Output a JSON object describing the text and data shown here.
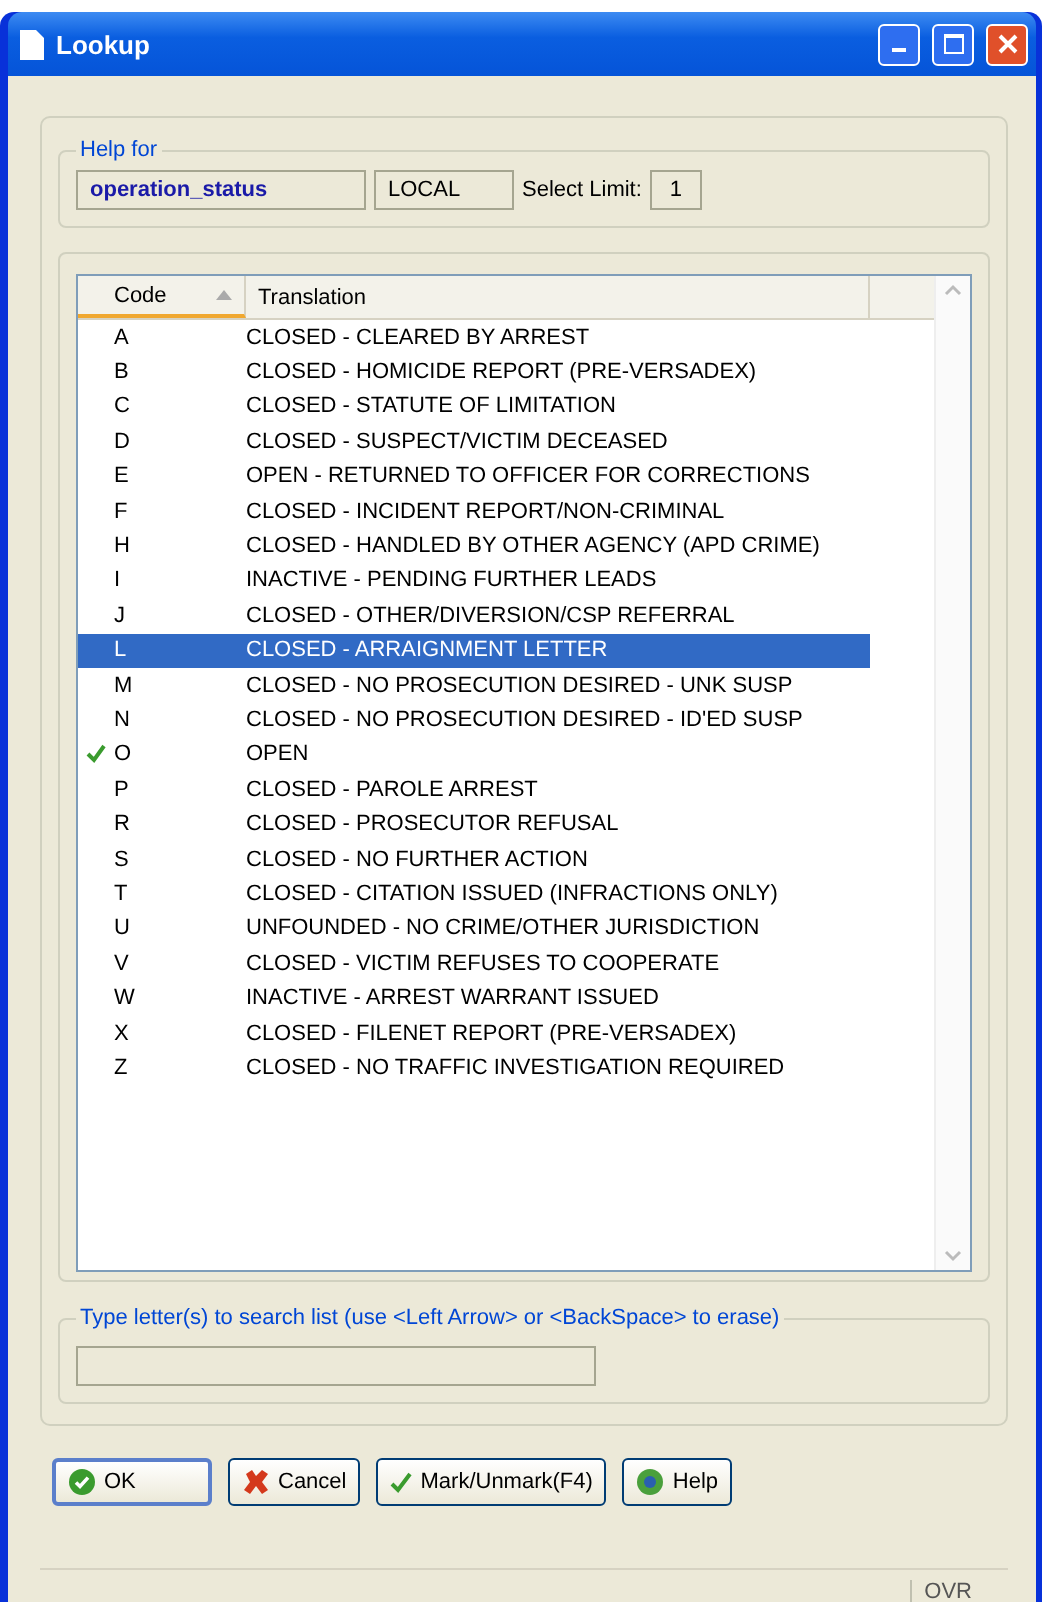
{
  "window": {
    "title": "Lookup"
  },
  "help_for": {
    "legend": "Help for",
    "field": "operation_status",
    "scope": "LOCAL",
    "select_limit_label": "Select Limit:",
    "select_limit": "1"
  },
  "table": {
    "columns": [
      {
        "label": "Code",
        "sorted": true
      },
      {
        "label": "Translation",
        "sorted": false
      }
    ],
    "rows": [
      {
        "code": "A",
        "translation": "CLOSED -  CLEARED BY ARREST",
        "selected": false,
        "checked": false
      },
      {
        "code": "B",
        "translation": "CLOSED - HOMICIDE REPORT (PRE-VERSADEX)",
        "selected": false,
        "checked": false
      },
      {
        "code": "C",
        "translation": "CLOSED - STATUTE OF LIMITATION",
        "selected": false,
        "checked": false
      },
      {
        "code": "D",
        "translation": "CLOSED - SUSPECT/VICTIM DECEASED",
        "selected": false,
        "checked": false
      },
      {
        "code": "E",
        "translation": "OPEN - RETURNED TO OFFICER FOR CORRECTIONS",
        "selected": false,
        "checked": false
      },
      {
        "code": "F",
        "translation": "CLOSED - INCIDENT REPORT/NON-CRIMINAL",
        "selected": false,
        "checked": false
      },
      {
        "code": "H",
        "translation": "CLOSED - HANDLED BY OTHER AGENCY (APD CRIME)",
        "selected": false,
        "checked": false
      },
      {
        "code": "I",
        "translation": "INACTIVE - PENDING FURTHER LEADS",
        "selected": false,
        "checked": false
      },
      {
        "code": "J",
        "translation": "CLOSED -  OTHER/DIVERSION/CSP REFERRAL",
        "selected": false,
        "checked": false
      },
      {
        "code": "L",
        "translation": "CLOSED -  ARRAIGNMENT LETTER",
        "selected": true,
        "checked": false
      },
      {
        "code": "M",
        "translation": "CLOSED - NO PROSECUTION DESIRED - UNK SUSP",
        "selected": false,
        "checked": false
      },
      {
        "code": "N",
        "translation": "CLOSED -  NO PROSECUTION DESIRED - ID'ED SUSP",
        "selected": false,
        "checked": false
      },
      {
        "code": "O",
        "translation": "OPEN",
        "selected": false,
        "checked": true
      },
      {
        "code": "P",
        "translation": "CLOSED -  PAROLE ARREST",
        "selected": false,
        "checked": false
      },
      {
        "code": "R",
        "translation": "CLOSED - PROSECUTOR REFUSAL",
        "selected": false,
        "checked": false
      },
      {
        "code": "S",
        "translation": "CLOSED - NO FURTHER ACTION",
        "selected": false,
        "checked": false
      },
      {
        "code": "T",
        "translation": "CLOSED - CITATION ISSUED (INFRACTIONS ONLY)",
        "selected": false,
        "checked": false
      },
      {
        "code": "U",
        "translation": "UNFOUNDED - NO CRIME/OTHER JURISDICTION",
        "selected": false,
        "checked": false
      },
      {
        "code": "V",
        "translation": "CLOSED - VICTIM REFUSES TO COOPERATE",
        "selected": false,
        "checked": false
      },
      {
        "code": "W",
        "translation": "INACTIVE -  ARREST WARRANT ISSUED",
        "selected": false,
        "checked": false
      },
      {
        "code": "X",
        "translation": "CLOSED - FILENET REPORT (PRE-VERSADEX)",
        "selected": false,
        "checked": false
      },
      {
        "code": "Z",
        "translation": "CLOSED - NO TRAFFIC INVESTIGATION REQUIRED",
        "selected": false,
        "checked": false
      }
    ]
  },
  "search": {
    "legend": "Type letter(s) to search list (use <Left Arrow> or <BackSpace> to erase)"
  },
  "buttons": [
    {
      "kind": "ok",
      "label": "OK"
    },
    {
      "kind": "cancel",
      "label": "Cancel"
    },
    {
      "kind": "mark",
      "label": "Mark/Unmark(F4)"
    },
    {
      "kind": "help",
      "label": "Help"
    }
  ],
  "status_bar": {
    "mode": "OVR"
  }
}
